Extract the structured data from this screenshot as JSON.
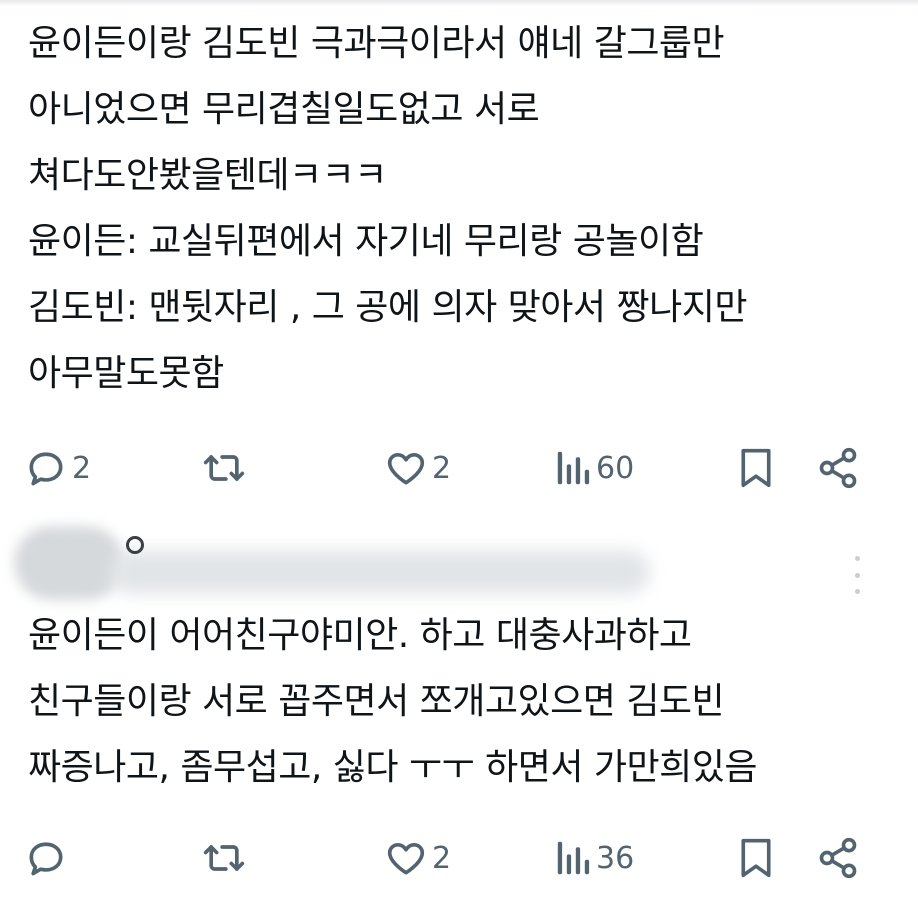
{
  "posts": [
    {
      "lines": [
        "윤이든이랑 김도빈 극과극이라서 얘네 갈그룹만",
        "아니었으면 무리겹칠일도없고 서로",
        "쳐다도안봤을텐데ㅋㅋㅋ",
        "윤이든: 교실뒤편에서 자기네 무리랑 공놀이함",
        "김도빈: 맨뒷자리 , 그 공에 의자 맞아서 짱나지만",
        "아무말도못함"
      ],
      "actions": {
        "replies": "2",
        "retweets": "",
        "likes": "2",
        "views": "60"
      }
    },
    {
      "lines": [
        "윤이든이 어어친구야미안. 하고 대충사과하고",
        "친구들이랑 서로 꼽주면서 쪼개고있으면 김도빈",
        "짜증나고, 좀무섭고, 싫다 ㅜㅜ 하면서 가만희있음"
      ],
      "actions": {
        "replies": "",
        "retweets": "",
        "likes": "2",
        "views": "36"
      }
    }
  ],
  "icons": {
    "reply": "reply-icon",
    "retweet": "retweet-icon",
    "like": "heart-icon",
    "views": "views-icon",
    "bookmark": "bookmark-icon",
    "share": "share-icon",
    "more": "more-icon"
  },
  "colors": {
    "text": "#0f1419",
    "muted": "#536471"
  }
}
